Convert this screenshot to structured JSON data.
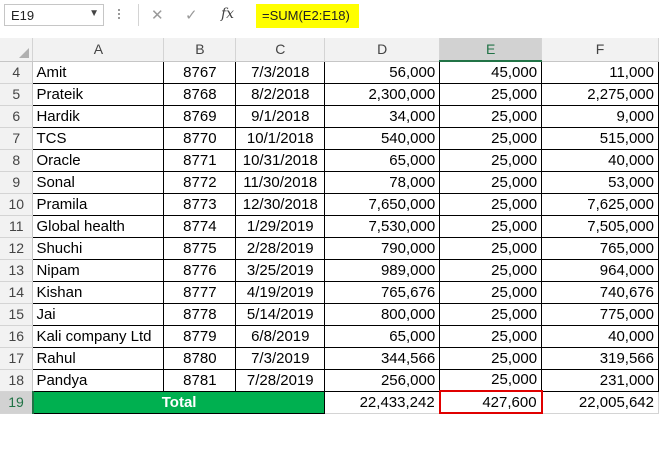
{
  "name_box": {
    "value": "E19"
  },
  "formula": {
    "value": "=SUM(E2:E18)",
    "highlight_color": "#ffff00"
  },
  "icons": {
    "cancel": "close-icon",
    "enter": "checkmark-icon",
    "function": "fx-icon"
  },
  "icon_glyphs": {
    "cancel": "✕",
    "enter": "✓",
    "fx": "fx",
    "dropdown": "▼"
  },
  "columns": [
    "A",
    "B",
    "C",
    "D",
    "E",
    "F"
  ],
  "selected_column": "E",
  "selected_row": "19",
  "rows": [
    {
      "num": "4",
      "cells": [
        "Amit",
        "8767",
        "7/3/2018",
        "56,000",
        "45,000",
        "11,000"
      ]
    },
    {
      "num": "5",
      "cells": [
        "Prateik",
        "8768",
        "8/2/2018",
        "2,300,000",
        "25,000",
        "2,275,000"
      ]
    },
    {
      "num": "6",
      "cells": [
        "Hardik",
        "8769",
        "9/1/2018",
        "34,000",
        "25,000",
        "9,000"
      ]
    },
    {
      "num": "7",
      "cells": [
        "TCS",
        "8770",
        "10/1/2018",
        "540,000",
        "25,000",
        "515,000"
      ]
    },
    {
      "num": "8",
      "cells": [
        "Oracle",
        "8771",
        "10/31/2018",
        "65,000",
        "25,000",
        "40,000"
      ]
    },
    {
      "num": "9",
      "cells": [
        "Sonal",
        "8772",
        "11/30/2018",
        "78,000",
        "25,000",
        "53,000"
      ]
    },
    {
      "num": "10",
      "cells": [
        "Pramila",
        "8773",
        "12/30/2018",
        "7,650,000",
        "25,000",
        "7,625,000"
      ]
    },
    {
      "num": "11",
      "cells": [
        "Global health",
        "8774",
        "1/29/2019",
        "7,530,000",
        "25,000",
        "7,505,000"
      ]
    },
    {
      "num": "12",
      "cells": [
        "Shuchi",
        "8775",
        "2/28/2019",
        "790,000",
        "25,000",
        "765,000"
      ]
    },
    {
      "num": "13",
      "cells": [
        "Nipam",
        "8776",
        "3/25/2019",
        "989,000",
        "25,000",
        "964,000"
      ]
    },
    {
      "num": "14",
      "cells": [
        "Kishan",
        "8777",
        "4/19/2019",
        "765,676",
        "25,000",
        "740,676"
      ]
    },
    {
      "num": "15",
      "cells": [
        "Jai",
        "8778",
        "5/14/2019",
        "800,000",
        "25,000",
        "775,000"
      ]
    },
    {
      "num": "16",
      "cells": [
        "Kali company Ltd",
        "8779",
        "6/8/2019",
        "65,000",
        "25,000",
        "40,000"
      ]
    },
    {
      "num": "17",
      "cells": [
        "Rahul",
        "8780",
        "7/3/2019",
        "344,566",
        "25,000",
        "319,566"
      ]
    },
    {
      "num": "18",
      "cells": [
        "Pandya",
        "8781",
        "7/28/2019",
        "256,000",
        "25,000",
        "231,000"
      ]
    }
  ],
  "total_row": {
    "num": "19",
    "label": "Total",
    "label_color": "#00b050",
    "d": "22,433,242",
    "e": "427,600",
    "f": "22,005,642",
    "selected_border_color": "#e00000"
  }
}
